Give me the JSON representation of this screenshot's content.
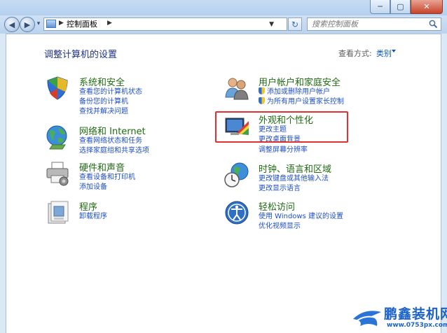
{
  "nav": {
    "breadcrumb": "控制面板",
    "search_placeholder": "搜索控制面板"
  },
  "window_buttons": {
    "minimize": "─",
    "maximize": "▢",
    "close": "✕"
  },
  "header": {
    "title": "调整计算机的设置",
    "view_by_label": "查看方式:",
    "view_by_value": "类别"
  },
  "categories": {
    "system": {
      "title": "系统和安全",
      "links": [
        "查看您的计算机状态",
        "备份您的计算机",
        "查找并解决问题"
      ]
    },
    "network": {
      "title": "网络和 Internet",
      "links": [
        "查看网络状态和任务",
        "选择家庭组和共享选项"
      ]
    },
    "hardware": {
      "title": "硬件和声音",
      "links": [
        "查看设备和打印机",
        "添加设备"
      ]
    },
    "programs": {
      "title": "程序",
      "links": [
        "卸载程序"
      ]
    },
    "users": {
      "title": "用户帐户和家庭安全",
      "links": [
        "添加或删除用户帐户",
        "为所有用户设置家长控制"
      ]
    },
    "appearance": {
      "title": "外观和个性化",
      "links": [
        "更改主题",
        "更改桌面背景",
        "调整屏幕分辨率"
      ]
    },
    "clock": {
      "title": "时钟、语言和区域",
      "links": [
        "更改键盘或其他输入法",
        "更改显示语言"
      ]
    },
    "ease": {
      "title": "轻松访问",
      "links": [
        "使用 Windows 建议的设置",
        "优化视频显示"
      ]
    }
  },
  "watermark": {
    "brand": "鹏鑫装机网",
    "url": "www.0753px.com"
  },
  "colors": {
    "title_blue": "#1e3287",
    "category_green": "#1f6b12",
    "link_blue": "#1f4fc2",
    "highlight_red": "#e03131"
  }
}
